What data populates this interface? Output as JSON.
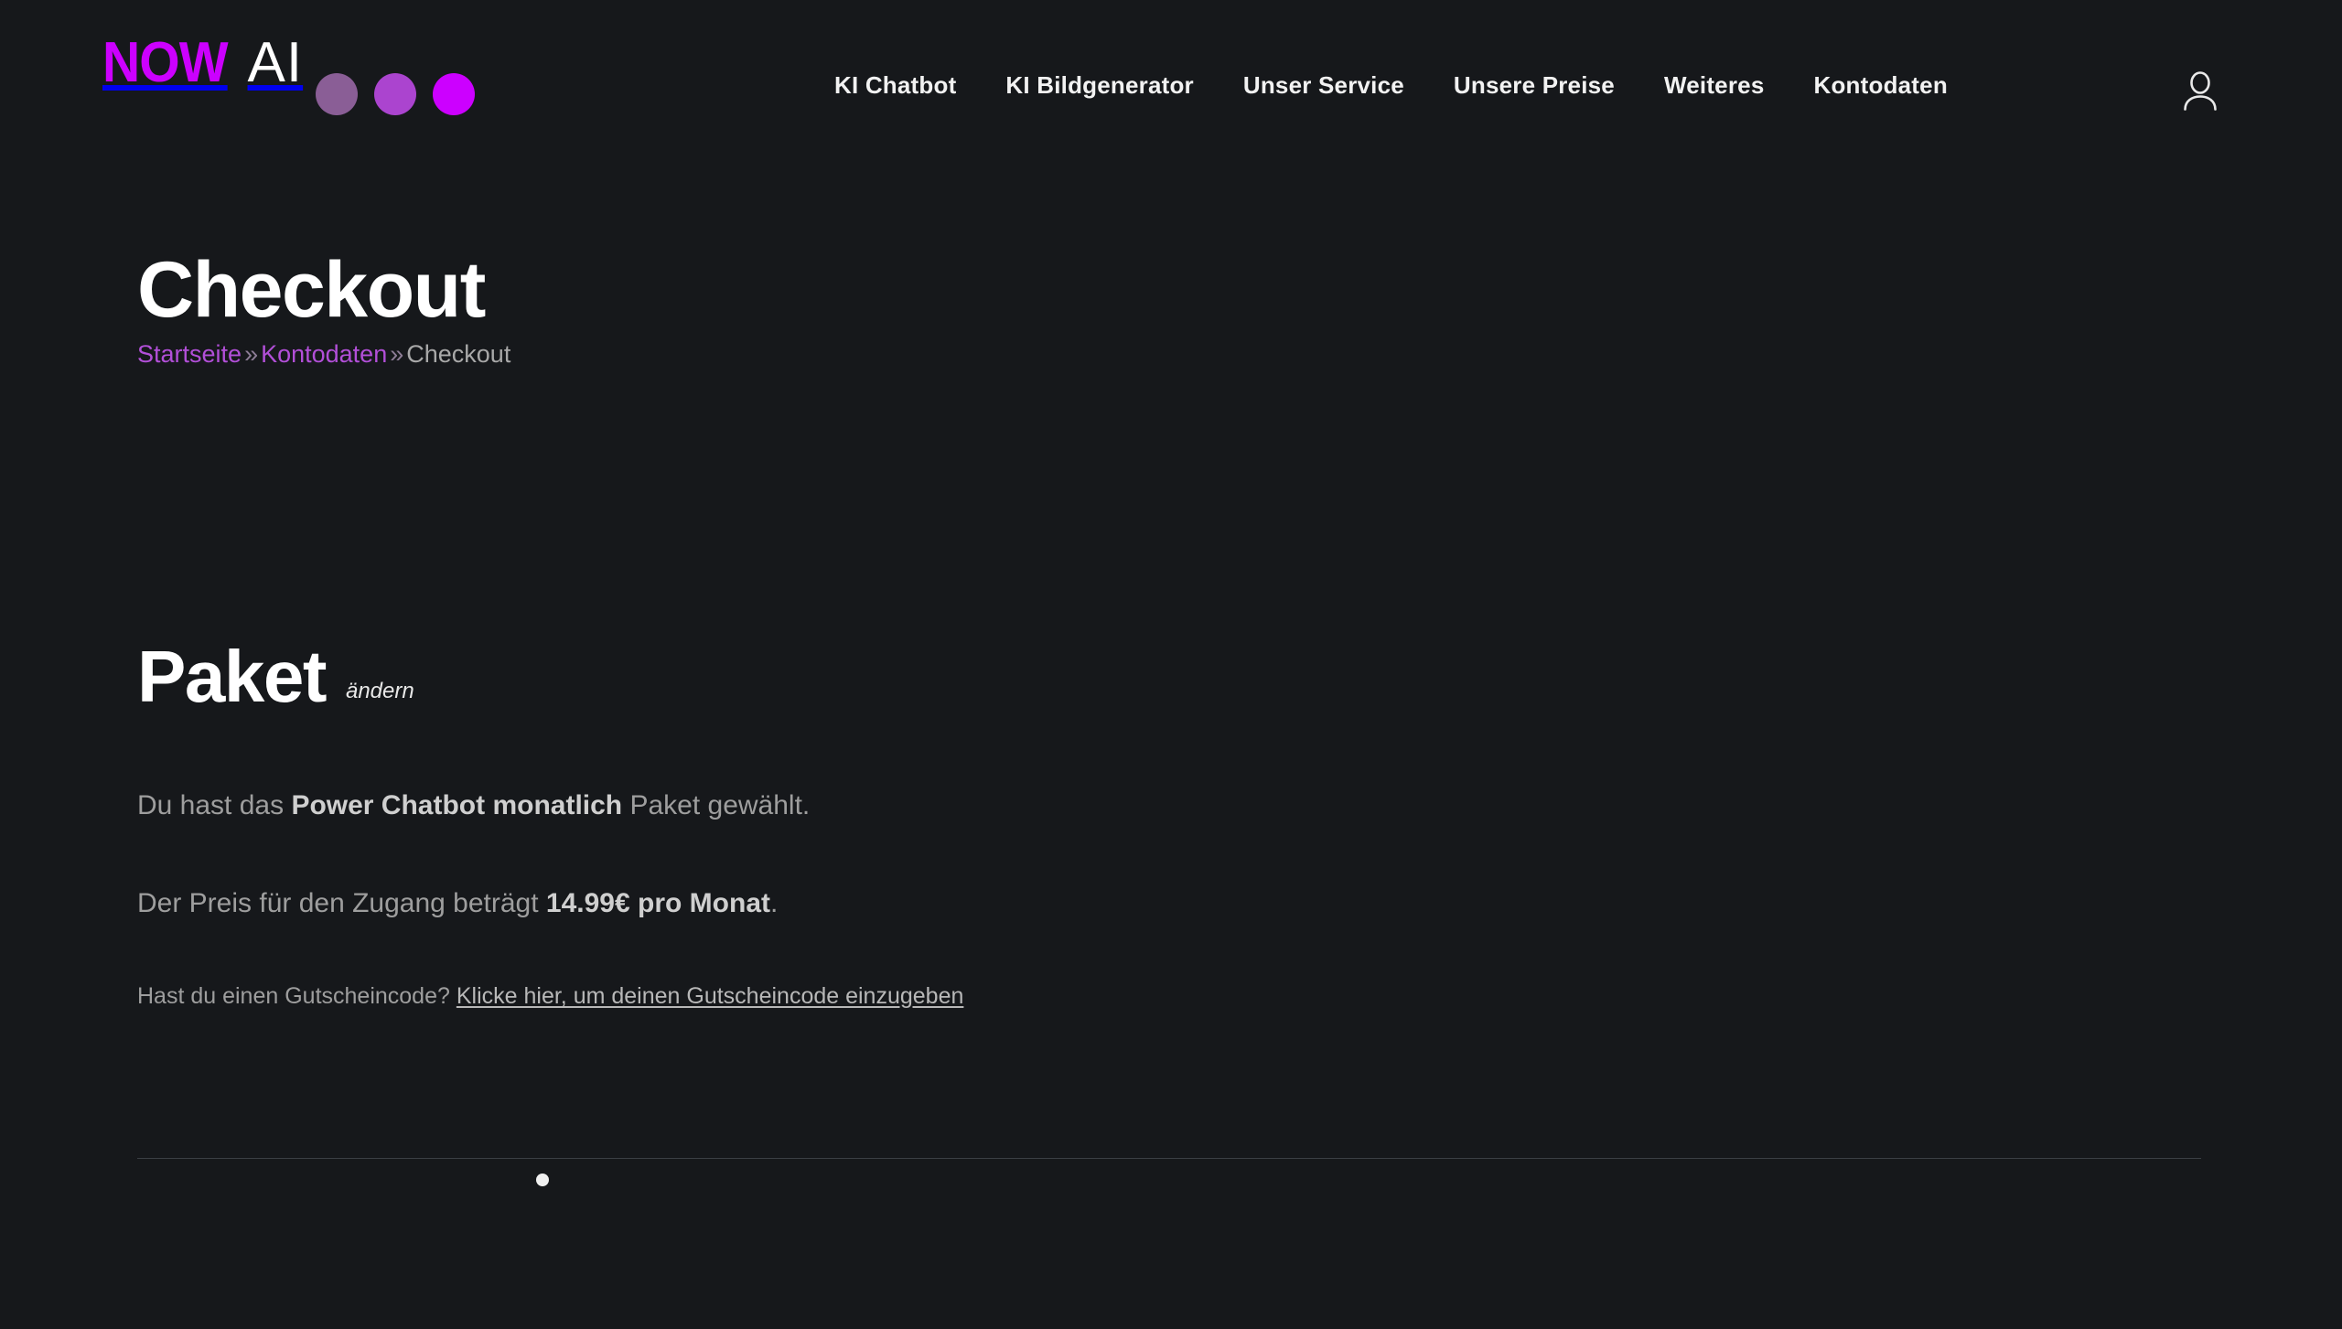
{
  "colors": {
    "background": "#16181b",
    "brand_magenta": "#cc00ff",
    "link_purple": "#b24fd8",
    "muted_text": "#9e9e9e",
    "divider": "#3b3f44",
    "dot_1": "#8a5e96",
    "dot_2": "#ab44cf",
    "dot_3": "#cc00ff"
  },
  "header": {
    "logo": {
      "primary": "NOW",
      "secondary": "AI",
      "dots": [
        "logo-dot-1",
        "logo-dot-2",
        "logo-dot-3"
      ]
    },
    "nav": [
      {
        "label": "KI Chatbot",
        "name": "nav-link-ki-chatbot"
      },
      {
        "label": "KI Bildgenerator",
        "name": "nav-link-ki-bildgenerator"
      },
      {
        "label": "Unser Service",
        "name": "nav-link-unser-service"
      },
      {
        "label": "Unsere Preise",
        "name": "nav-link-unsere-preise"
      },
      {
        "label": "Weiteres",
        "name": "nav-link-weiteres"
      },
      {
        "label": "Kontodaten",
        "name": "nav-link-kontodaten"
      }
    ],
    "account_icon": "user-account-icon"
  },
  "page": {
    "title": "Checkout",
    "breadcrumb": {
      "home": "Startseite",
      "sep1": "»",
      "account": "Kontodaten",
      "sep2": "»",
      "current": "Checkout"
    }
  },
  "order": {
    "section_title": "Paket",
    "change_label": "ändern",
    "package_line": {
      "prefix": "Du hast das ",
      "package_name": "Power Chatbot monatlich",
      "suffix": " Paket gewählt."
    },
    "price_line": {
      "prefix": "Der Preis für den Zugang beträgt ",
      "price": "14.99€ pro Monat",
      "suffix": "."
    },
    "coupon": {
      "question": "Hast du einen Gutscheincode?",
      "link_label": "Klicke hier, um deinen Gutscheincode einzugeben"
    }
  },
  "footer_area": {
    "loading_indicator": "loading-dot"
  }
}
